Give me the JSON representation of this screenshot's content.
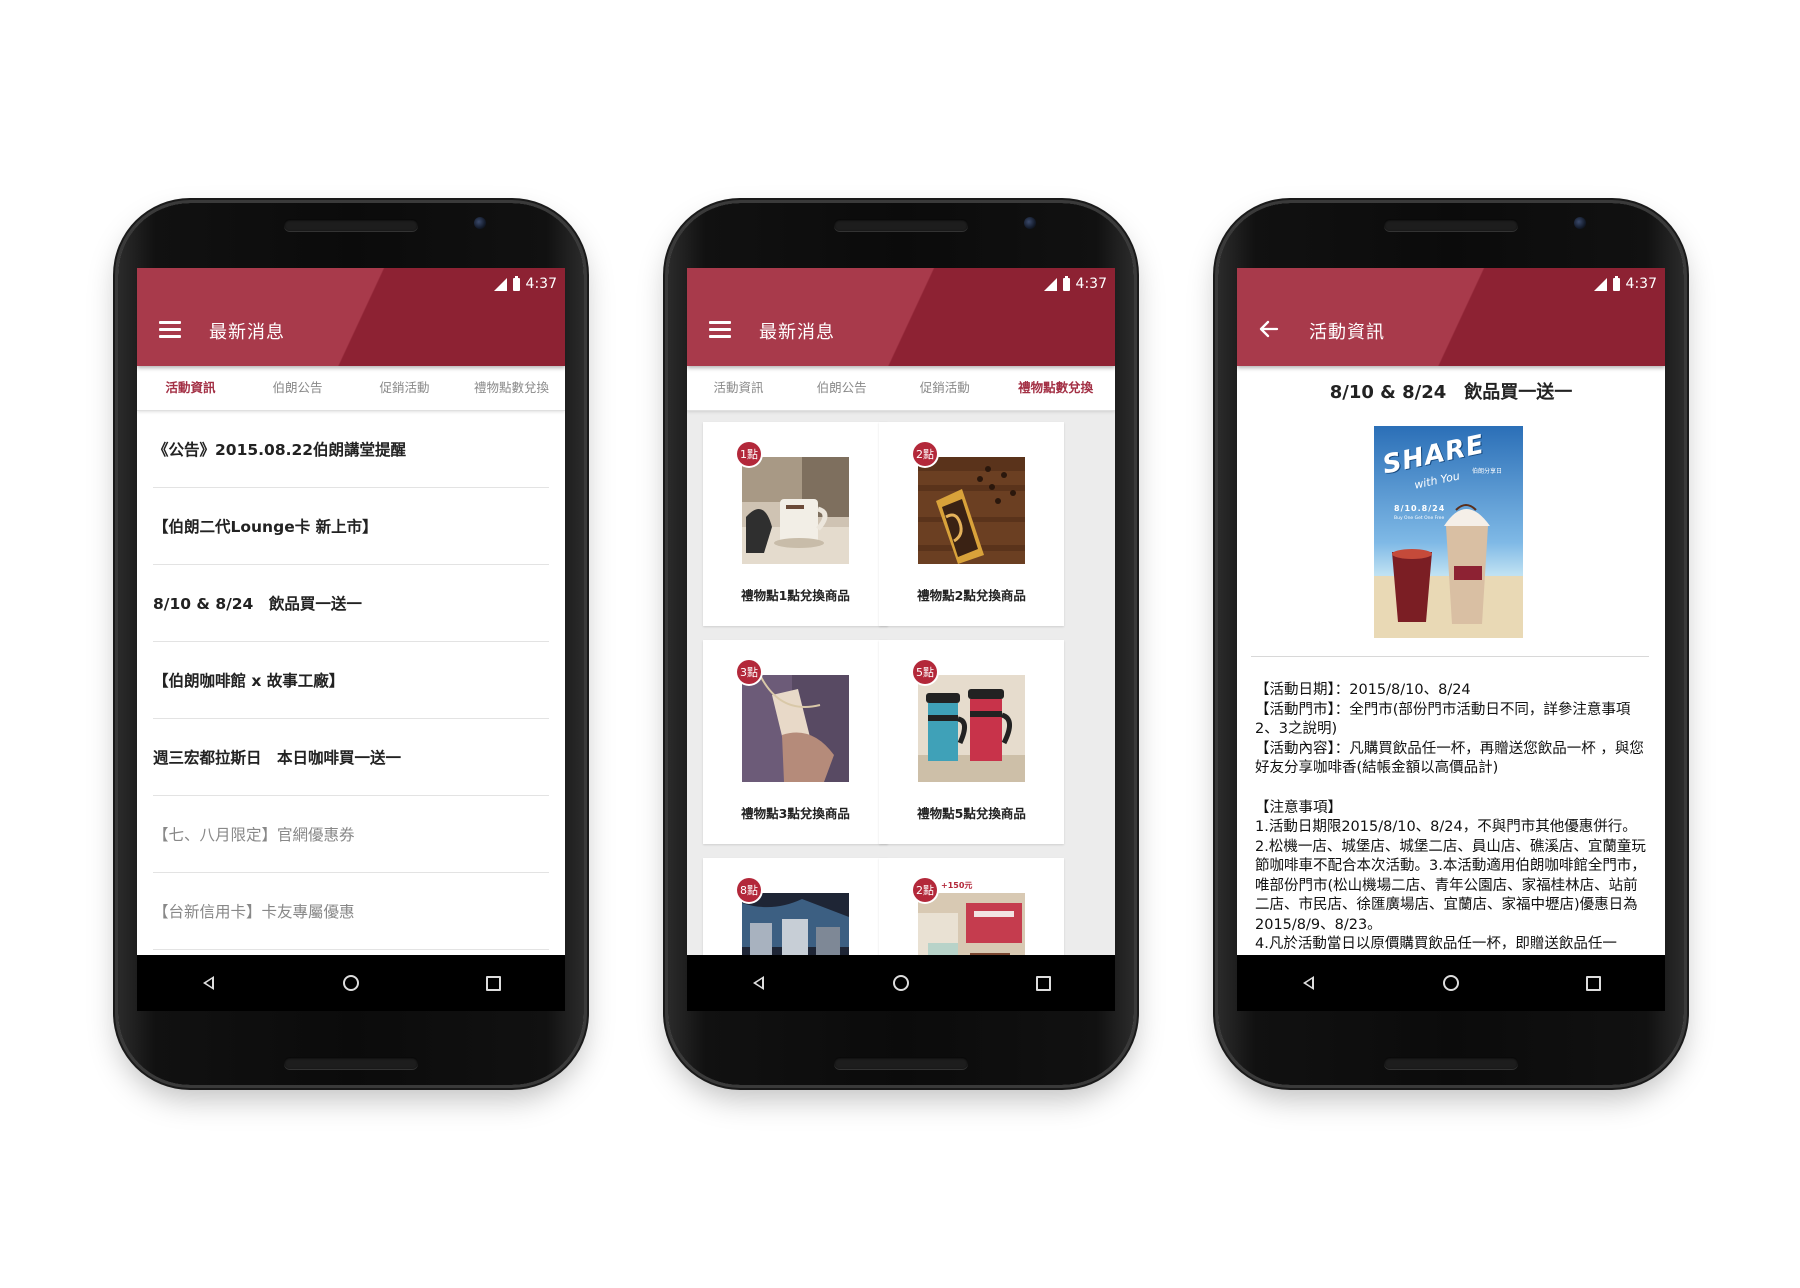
{
  "status": {
    "time": "4:37"
  },
  "phone1": {
    "title": "最新消息",
    "tabs": [
      "活動資訊",
      "伯朗公告",
      "促銷活動",
      "禮物點數兌換"
    ],
    "list": [
      {
        "text": "《公告》2015.08.22伯朗講堂提醒"
      },
      {
        "text": "【伯朗二代Lounge卡 新上市】"
      },
      {
        "text": "8/10 & 8/24　飲品買一送一"
      },
      {
        "text": "【伯朗咖啡館 x 故事工廠】"
      },
      {
        "text": "週三宏都拉斯日　本日咖啡買一送一"
      },
      {
        "text": "【七、八月限定】官網優惠券"
      },
      {
        "text": "【台新信用卡】卡友專屬優惠"
      }
    ]
  },
  "phone2": {
    "title": "最新消息",
    "tabs": [
      "活動資訊",
      "伯朗公告",
      "促銷活動",
      "禮物點數兌換"
    ],
    "cards": [
      {
        "badge": "1點",
        "caption": "禮物點1點兌換商品",
        "icon": "coffee-mug-photo"
      },
      {
        "badge": "2點",
        "caption": "禮物點2點兌換商品",
        "icon": "coffee-bean-bag-photo"
      },
      {
        "badge": "3點",
        "caption": "禮物點3點兌換商品",
        "icon": "card-in-hand-photo"
      },
      {
        "badge": "5點",
        "caption": "禮物點5點兌換商品",
        "icon": "travel-mugs-photo"
      },
      {
        "badge": "8點",
        "caption": "",
        "icon": "tumbler-photo"
      },
      {
        "badge": "2點",
        "caption": "",
        "icon": "gift-set-photo",
        "extra": "+150元"
      }
    ]
  },
  "phone3": {
    "title": "活動資訊",
    "detail_title": "8/10 & 8/24　飲品買一送一",
    "poster": {
      "headline": "SHARE",
      "sub": "with You",
      "dates": "8/10.8/24",
      "tagline": "Buy One Get One Free",
      "brand": "伯朗分享日"
    },
    "body": [
      "【活動日期】：2015/8/10、8/24",
      "【活動門市】：全門市(部份門市活動日不同，詳參注意事項2、3之說明)",
      "【活動內容】：凡購買飲品任一杯，再贈送您飲品一杯 ，與您好友分享咖啡香(結帳金額以高價品計)",
      "",
      "【注意事項】",
      "1.活動日期限2015/8/10、8/24，不與門市其他優惠併行。",
      "2.松機一店、城堡店、城堡二店、員山店、礁溪店、宜蘭童玩節咖啡車不配合本次活動。3.本活動適用伯朗咖啡館全門市，唯部份門市(松山機場二店、青年公園店、家福桂林店、站前二店、市民店、徐匯廣場店、宜蘭店、家福中壢店)優惠日為2015/8/9、8/23。",
      "4.凡於活動當日以原價購買飲品任一杯，即贈送飲品任一"
    ]
  },
  "colors": {
    "appbar": "#8d2233",
    "appbar_light": "#a83a4b",
    "tab_active": "#a33045",
    "badge": "#b3283a"
  }
}
